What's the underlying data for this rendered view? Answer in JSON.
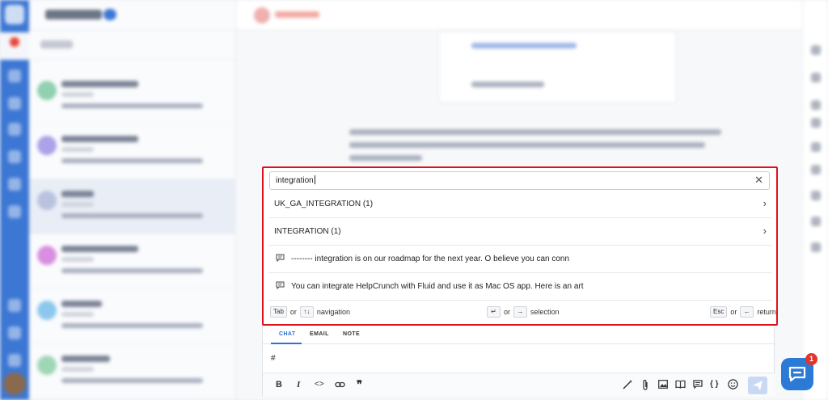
{
  "popup": {
    "search_value": "integration",
    "clear_icon": "close-icon",
    "results": [
      {
        "type": "folder",
        "label": "UK_GA_INTEGRATION (1)"
      },
      {
        "type": "folder",
        "label": "INTEGRATION (1)"
      },
      {
        "type": "snippet",
        "label": "-------- integration is on our roadmap for the next year. O believe you can conn"
      },
      {
        "type": "snippet",
        "label": "You can integrate HelpCrunch with Fluid and use it as Mac OS app. Here is an art"
      }
    ],
    "footer": {
      "nav_key1": "Tab",
      "nav_or": "or",
      "nav_key2": "↑↓",
      "nav_label": "navigation",
      "sel_key1": "↵",
      "sel_or": "or",
      "sel_key2": "→",
      "sel_label": "selection",
      "ret_key1": "Esc",
      "ret_or": "or",
      "ret_key2": "←",
      "ret_label": "return"
    }
  },
  "composer": {
    "tabs": [
      "CHAT",
      "EMAIL",
      "NOTE"
    ],
    "active_tab": "CHAT",
    "text": "#",
    "toolbar_icons": [
      "bold-icon",
      "italic-icon",
      "code-icon",
      "link-icon",
      "quote-icon",
      "magic-wand-icon",
      "paperclip-icon",
      "image-icon",
      "knowledge-base-icon",
      "snippet-icon",
      "variables-icon",
      "emoji-icon",
      "send-icon"
    ],
    "bold_glyph": "B",
    "italic_glyph": "I",
    "code_glyph": "<>",
    "quote_glyph": "❞",
    "variables_glyph": "{ }"
  },
  "widget": {
    "badge_count": "1"
  },
  "colors": {
    "highlight_border": "#e0101a",
    "accent": "#2e6fd8",
    "rail": "#3c77d4",
    "badge": "#e0342c"
  }
}
